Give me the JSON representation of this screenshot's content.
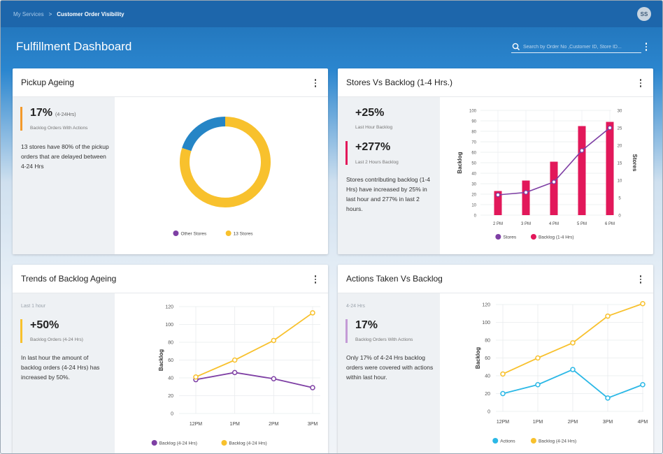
{
  "breadcrumb": {
    "parent": "My Services",
    "separator": ">",
    "current": "Customer Order Visibility"
  },
  "user": {
    "initials": "SS"
  },
  "page": {
    "title": "Fulfillment Dashboard"
  },
  "search": {
    "placeholder": "Search by Order No ,Customer ID, Store ID..."
  },
  "colors": {
    "header": "#1d66ab",
    "orange": "#f39a2b",
    "red": "#e2185a",
    "yellow": "#f8c12d",
    "purple": "#7e3fa4",
    "cyan": "#2bb8e6",
    "donut_blue": "#2585c6",
    "lilac": "#c49bd6"
  },
  "cards": {
    "pickup_ageing": {
      "title": "Pickup Ageing",
      "kpi": {
        "value": "17%",
        "unit": "(4-24Hrs)",
        "label": "Backlog Orders With Actions"
      },
      "note": "13 stores have 80% of the pickup orders that are delayed between 4-24 Hrs"
    },
    "stores_vs_backlog": {
      "title": "Stores Vs Backlog (1-4 Hrs.)",
      "kpi1": {
        "value": "+25%",
        "label": "Last Hour Backlog"
      },
      "kpi2": {
        "value": "+277%",
        "label": "Last 2 Hours Backlog"
      },
      "note": "Stores contributing backlog (1-4 Hrs) have increased by 25% in last hour and 277% in last 2 hours."
    },
    "trends_backlog": {
      "title": "Trends of Backlog Ageing",
      "period": "Last 1 hour",
      "kpi": {
        "value": "+50%",
        "label": "Backlog Orders (4-24 Hrs)"
      },
      "note": "In last hour the amount of backlog orders (4-24 Hrs) has increased by 50%."
    },
    "actions_vs_backlog": {
      "title": "Actions Taken Vs Backlog",
      "period": "4-24 Hrs",
      "kpi": {
        "value": "17%",
        "label": "Backlog Orders With Actions"
      },
      "note": "Only 17% of 4-24 Hrs backlog orders were covered with actions within last hour."
    }
  },
  "chart_data": [
    {
      "id": "pickup",
      "type": "pie",
      "series": [
        {
          "name": "Other Stores",
          "value": 20,
          "color": "#2585c6"
        },
        {
          "name": "13 Stores",
          "value": 80,
          "color": "#f8c12d"
        }
      ],
      "legend": [
        "Other Stores",
        "13 Stores"
      ],
      "legend_colors": [
        "#7e3fa4",
        "#f8c12d"
      ],
      "legend_position": "bottom"
    },
    {
      "id": "stores",
      "type": "bar",
      "categories": [
        "2 PM",
        "3 PM",
        "4 PM",
        "5 PM",
        "6 PM"
      ],
      "ylabel": "Backlog",
      "y2label": "Stores",
      "ylim": [
        0,
        100
      ],
      "yticks": [
        0,
        10,
        20,
        30,
        40,
        50,
        60,
        70,
        80,
        90,
        100
      ],
      "y2lim": [
        0,
        30
      ],
      "y2ticks": [
        0,
        5,
        10,
        15,
        20,
        25,
        30
      ],
      "series": [
        {
          "name": "Backlog (1-4 Hrs)",
          "kind": "bar",
          "axis": "left",
          "color": "#e2185a",
          "values": [
            23,
            33,
            51,
            85,
            89
          ]
        },
        {
          "name": "Stores",
          "kind": "line",
          "axis": "right",
          "color": "#7e3fa4",
          "values": [
            5.8,
            6.5,
            9.5,
            18.5,
            25
          ]
        }
      ],
      "legend_position": "bottom"
    },
    {
      "id": "trends",
      "type": "line",
      "categories": [
        "12PM",
        "1PM",
        "2PM",
        "3PM"
      ],
      "ylabel": "Backlog",
      "ylim": [
        0,
        120
      ],
      "yticks": [
        0,
        20,
        40,
        60,
        80,
        100,
        120
      ],
      "series": [
        {
          "name": "Backlog (4-24 Hrs)",
          "color": "#7e3fa4",
          "values": [
            38,
            46,
            39,
            29
          ]
        },
        {
          "name": "Backlog (4-24 Hrs)",
          "color": "#f8c12d",
          "values": [
            41,
            60,
            82,
            113
          ]
        }
      ],
      "legend_position": "bottom"
    },
    {
      "id": "actions",
      "type": "line",
      "categories": [
        "12PM",
        "1PM",
        "2PM",
        "3PM",
        "4PM"
      ],
      "ylabel": "Backlog",
      "ylim": [
        0,
        120
      ],
      "yticks": [
        0,
        20,
        40,
        60,
        80,
        100,
        120
      ],
      "series": [
        {
          "name": "Actions",
          "color": "#2bb8e6",
          "values": [
            20,
            30,
            47,
            15,
            30
          ]
        },
        {
          "name": "Backlog (4-24 Hrs)",
          "color": "#f8c12d",
          "values": [
            42,
            60,
            77,
            107,
            121
          ]
        }
      ],
      "legend_position": "bottom"
    }
  ]
}
